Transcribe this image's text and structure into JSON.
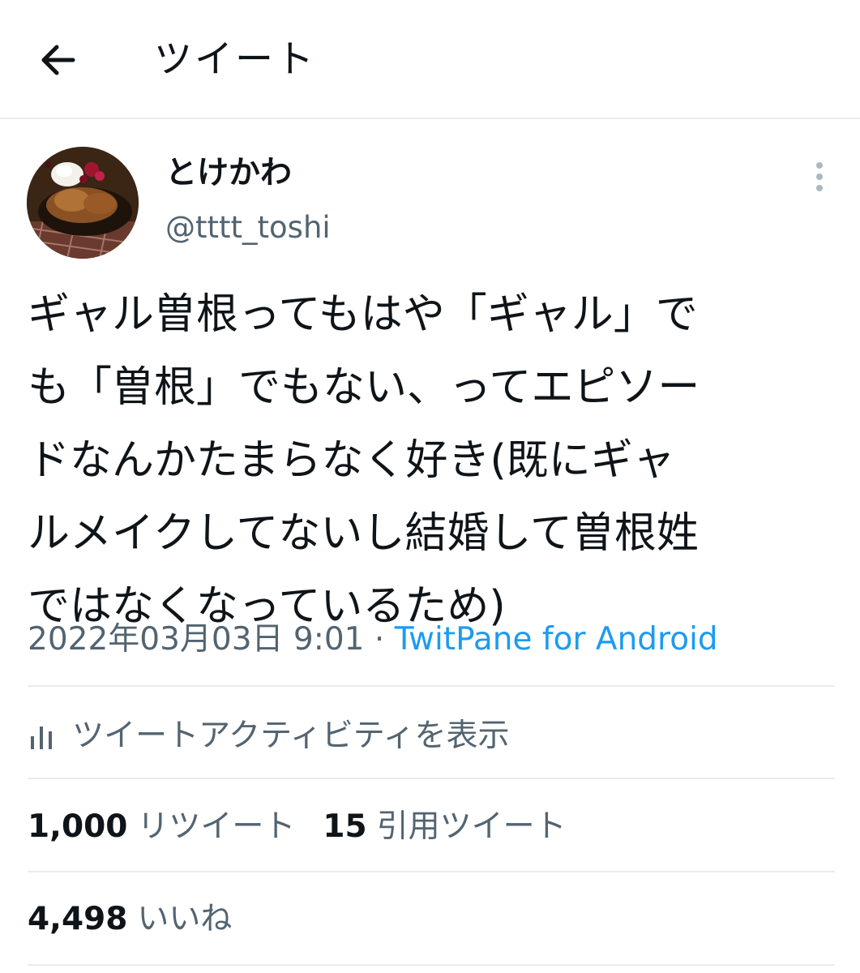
{
  "header": {
    "title": "ツイート",
    "back_icon": "arrow-left-icon"
  },
  "author": {
    "display_name": "とけかわ",
    "handle": "@tttt_toshi",
    "more_icon": "more-vertical-icon"
  },
  "tweet": {
    "text": "ギャル曽根ってもはや「ギャル」で\nも「曽根」でもない、ってエピソー\nドなんかたまらなく好き(既にギャ\nルメイクしてないし結婚して曽根姓\nではなくなっているため)",
    "datetime": "2022年03月03日 9:01",
    "separator": "·",
    "source": "TwitPane for Android"
  },
  "activity": {
    "icon": "bar-chart-icon",
    "label": "ツイートアクティビティを表示"
  },
  "stats": {
    "retweets": {
      "count": "1,000",
      "label": "リツイート"
    },
    "quotes": {
      "count": "15",
      "label": "引用ツイート"
    },
    "likes": {
      "count": "4,498",
      "label": "いいね"
    }
  },
  "colors": {
    "text": "#0f1419",
    "secondary": "#536471",
    "link": "#1d9bf0",
    "divider": "#e6ecf0"
  }
}
